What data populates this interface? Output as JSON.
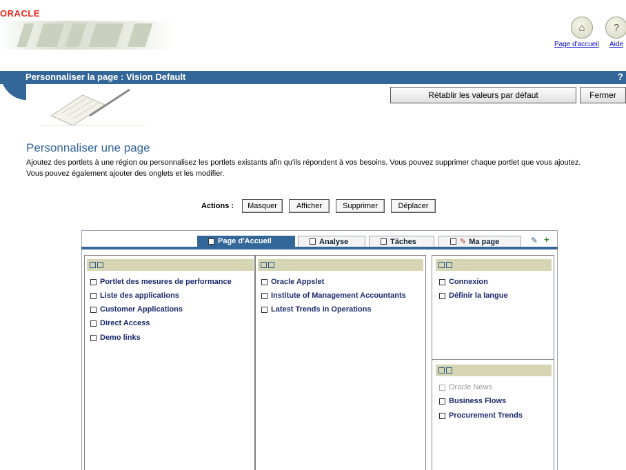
{
  "header": {
    "logo_text": "ORACLE",
    "home_link": "Page d'accueil",
    "help_link": "Aide"
  },
  "title_bar": {
    "title": "Personnaliser la page : Vision Default",
    "help_glyph": "?"
  },
  "toolbar": {
    "reset_label": "Rétablir les valeurs par défaut",
    "close_label": "Fermer"
  },
  "page": {
    "heading": "Personnaliser une page",
    "description": "Ajoutez des portlets à une région ou personnalisez les portlets existants afin qu'ils répondent à vos besoins. Vous pouvez supprimer chaque portlet que vous ajoutez. Vous pouvez également ajouter des onglets et les modifier."
  },
  "actions": {
    "label": "Actions :",
    "buttons": [
      "Masquer",
      "Afficher",
      "Supprimer",
      "Déplacer"
    ]
  },
  "tabs": [
    {
      "label": "Page d'Accueil",
      "active": true
    },
    {
      "label": "Analyse",
      "active": false
    },
    {
      "label": "Tâches",
      "active": false
    },
    {
      "label": "Ma page",
      "active": false
    }
  ],
  "regions": {
    "left": [
      "Portlet des mesures de performance",
      "Liste des applications",
      "Customer Applications",
      "Direct Access",
      "Demo links"
    ],
    "middle": [
      "Oracle Appslet",
      "Institute of Management Accountants",
      "Latest Trends in Operations"
    ],
    "right_top": [
      "Connexion",
      "Définir la langue"
    ],
    "right_bottom": [
      "Oracle News",
      "Business Flows",
      "Procurement Trends"
    ]
  },
  "icons": {
    "home": "home-icon",
    "help": "help-icon",
    "edit_tab": "pencil-icon",
    "region_icons": [
      "add-portlet-icon",
      "window-icon"
    ]
  },
  "colors": {
    "brand_red": "#e8291c",
    "title_blue": "#336699",
    "region_header": "#d6d6b4",
    "link": "#1a2a6c"
  }
}
